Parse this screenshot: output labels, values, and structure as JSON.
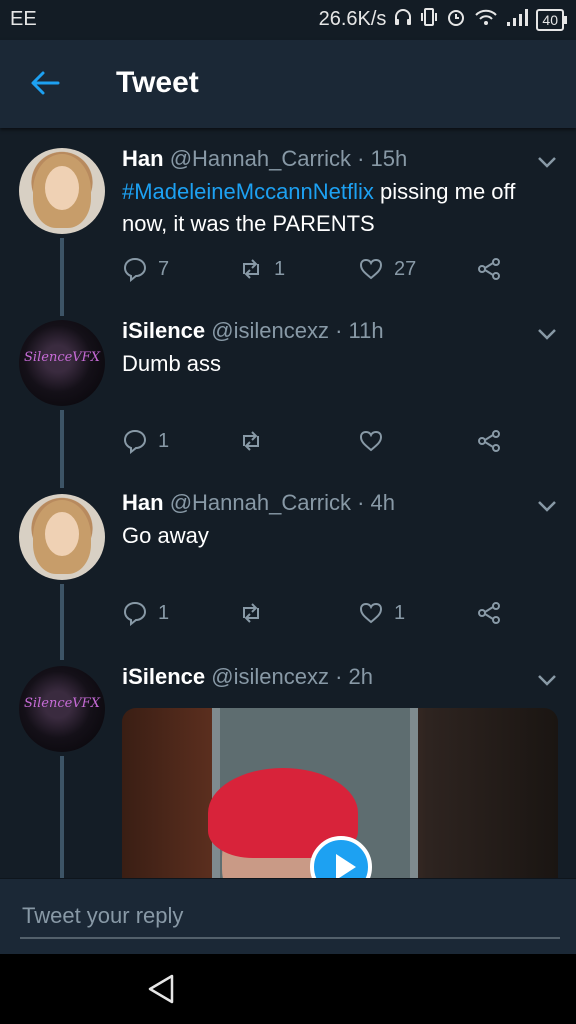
{
  "status_bar": {
    "carrier": "EE",
    "net_speed": "26.6K/s",
    "battery": "40",
    "icons": [
      "headset-icon",
      "vibrate-icon",
      "alarm-icon",
      "wifi-icon",
      "signal-icon",
      "battery-icon"
    ]
  },
  "header": {
    "title": "Tweet",
    "back_icon": "arrow-left-icon"
  },
  "tweets": [
    {
      "name": "Han",
      "handle": "@Hannah_Carrick",
      "time": "· 15h",
      "hashtag": "#MadeleineMccannNetflix",
      "text": " pissing me off now, it was the PARENTS",
      "replies": "7",
      "retweets": "1",
      "likes": "27"
    },
    {
      "name": "iSilence",
      "handle": "@isilencexz",
      "time": "· 11h",
      "text": "Dumb ass",
      "replies": "1",
      "retweets": "",
      "likes": "",
      "avatar_logo": "SilenceVFX"
    },
    {
      "name": "Han",
      "handle": "@Hannah_Carrick",
      "time": "· 4h",
      "text": "Go away",
      "replies": "1",
      "retweets": "",
      "likes": "1"
    },
    {
      "name": "iSilence",
      "handle": "@isilencexz",
      "time": "· 2h",
      "avatar_logo": "SilenceVFX",
      "media": "video"
    }
  ],
  "reply": {
    "placeholder": "Tweet your reply"
  },
  "colors": {
    "background": "#141d26",
    "bar": "#1b2836",
    "accent": "#1da1f2",
    "muted": "#8899a6"
  }
}
